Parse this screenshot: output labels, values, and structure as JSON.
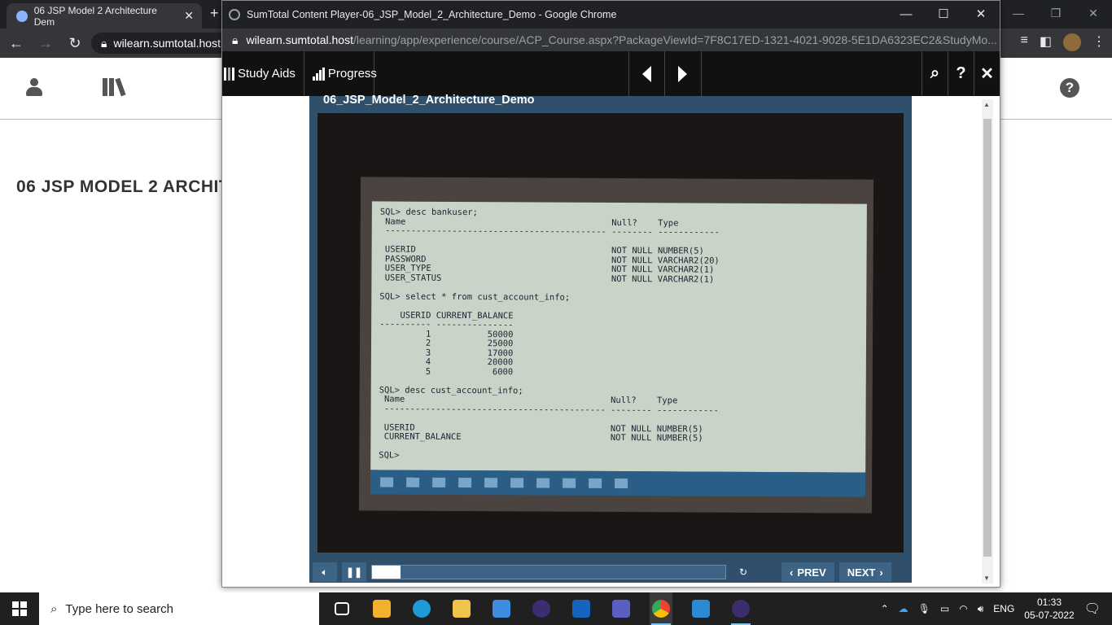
{
  "background_browser": {
    "tab_title": "06 JSP Model 2 Architecture Dem",
    "close_tab": "✕",
    "new_tab": "+",
    "url_host": "wilearn.sumtotal.host",
    "page_title": "06 JSP MODEL 2 ARCHIT",
    "window_controls": [
      "—",
      "❐",
      "✕"
    ]
  },
  "popup": {
    "window_title": "SumTotal Content Player-06_JSP_Model_2_Architecture_Demo - Google Chrome",
    "window_controls": [
      "—",
      "☐",
      "✕"
    ],
    "url_host": "wilearn.sumtotal.host",
    "url_path": "/learning/app/experience/course/ACP_Course.aspx?PackageViewId=7F8C17ED-1321-4021-9028-5E1DA6323EC2&StudyMo...",
    "toolbar": {
      "study_aids": "Study Aids",
      "progress": "Progress",
      "search": "⌕",
      "help": "?",
      "close": "✕"
    },
    "video": {
      "title": "06_JSP_Model_2_Architecture_Demo",
      "progress_fraction": 0.08,
      "prev_label": "PREV",
      "next_label": "NEXT",
      "screen_text": [
        "SQL> desc bankuser;",
        " Name                                        Null?    Type",
        " ------------------------------------------- -------- ------------",
        "",
        " USERID                                      NOT NULL NUMBER(5)",
        " PASSWORD                                    NOT NULL VARCHAR2(20)",
        " USER_TYPE                                   NOT NULL VARCHAR2(1)",
        " USER_STATUS                                 NOT NULL VARCHAR2(1)",
        "",
        "SQL> select * from cust_account_info;",
        "",
        "    USERID CURRENT_BALANCE",
        "---------- ---------------",
        "         1           50000",
        "         2           25000",
        "         3           17000",
        "         4           20000",
        "         5            6000",
        "",
        "SQL> desc cust_account_info;",
        " Name                                        Null?    Type",
        " ------------------------------------------- -------- ------------",
        "",
        " USERID                                      NOT NULL NUMBER(5)",
        " CURRENT_BALANCE                             NOT NULL NUMBER(5)",
        "",
        "SQL>"
      ]
    }
  },
  "taskbar": {
    "search_placeholder": "Type here to search",
    "language": "ENG",
    "time": "01:33",
    "date": "05-07-2022"
  }
}
